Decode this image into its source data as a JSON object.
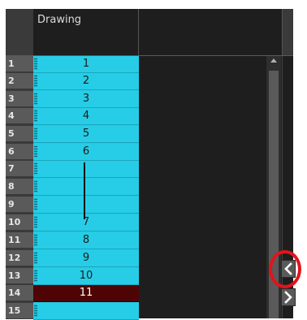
{
  "column": {
    "name": "Drawing"
  },
  "rows": [
    {
      "num": "1",
      "value": "1"
    },
    {
      "num": "2",
      "value": "2"
    },
    {
      "num": "3",
      "value": "3"
    },
    {
      "num": "4",
      "value": "4"
    },
    {
      "num": "5",
      "value": "5"
    },
    {
      "num": "6",
      "value": "6"
    },
    {
      "num": "7",
      "value": ""
    },
    {
      "num": "8",
      "value": ""
    },
    {
      "num": "9",
      "value": ""
    },
    {
      "num": "10",
      "value": "7"
    },
    {
      "num": "11",
      "value": "8"
    },
    {
      "num": "12",
      "value": "9"
    },
    {
      "num": "13",
      "value": "10"
    },
    {
      "num": "14",
      "value": "11",
      "selected": true
    },
    {
      "num": "15",
      "value": ""
    }
  ],
  "colors": {
    "cell": "#27cde6",
    "selected_cell": "#4e0405",
    "highlight": "#e0141c"
  },
  "icons": {
    "collapse": "chevron-left-icon",
    "expand": "chevron-right-icon",
    "scroll_up": "triangle-up-icon"
  }
}
